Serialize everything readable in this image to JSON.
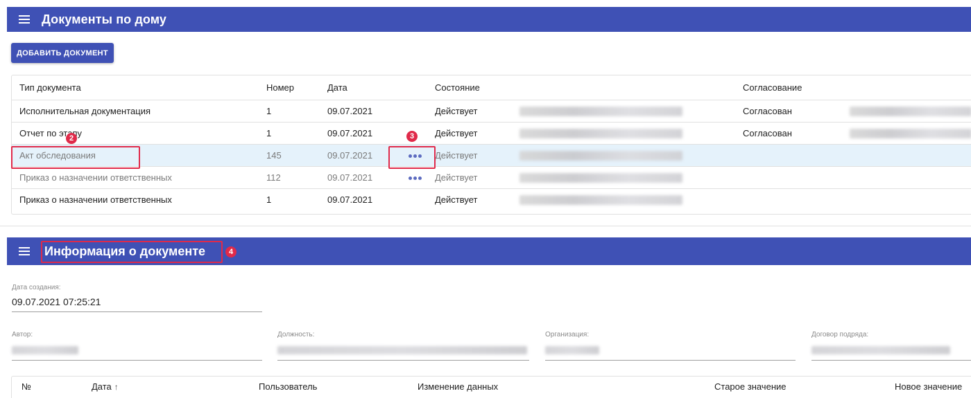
{
  "header": {
    "title": "Документы по дому"
  },
  "toolbar": {
    "add_label": "ДОБАВИТЬ ДОКУМЕНТ"
  },
  "documents": {
    "columns": [
      "Тип документа",
      "Номер",
      "Дата",
      "Состояние",
      "Согласование"
    ],
    "rows": [
      {
        "type": "Исполнительная документация",
        "number": "1",
        "date": "09.07.2021",
        "state": "Действует",
        "approval": "Согласован",
        "actions": false,
        "dim": false,
        "selected": false
      },
      {
        "type": "Отчет по этапу",
        "number": "1",
        "date": "09.07.2021",
        "state": "Действует",
        "approval": "Согласован",
        "actions": false,
        "dim": false,
        "selected": false
      },
      {
        "type": "Акт обследования",
        "number": "145",
        "date": "09.07.2021",
        "state": "Действует",
        "approval": "",
        "actions": true,
        "dim": true,
        "selected": true
      },
      {
        "type": "Приказ о назначении ответственных",
        "number": "112",
        "date": "09.07.2021",
        "state": "Действует",
        "approval": "",
        "actions": true,
        "dim": true,
        "selected": false
      },
      {
        "type": "Приказ о назначении ответственных",
        "number": "1",
        "date": "09.07.2021",
        "state": "Действует",
        "approval": "",
        "actions": false,
        "dim": false,
        "selected": false
      }
    ]
  },
  "annotations": [
    "2",
    "3",
    "4"
  ],
  "info": {
    "title": "Информация о документе",
    "created_label": "Дата создания:",
    "created_value": "09.07.2021 07:25:21",
    "author_label": "Автор:",
    "position_label": "Должность:",
    "organization_label": "Организация:",
    "contract_label": "Договор подряда:"
  },
  "history": {
    "columns": [
      "№",
      "Дата",
      "Пользователь",
      "Изменение данных",
      "Старое значение",
      "Новое значение"
    ],
    "sort_icon": "arrow-up-icon"
  },
  "colors": {
    "primary": "#3f51b5",
    "selected_row": "#e5f2fb",
    "annotation": "#e02a4a"
  }
}
